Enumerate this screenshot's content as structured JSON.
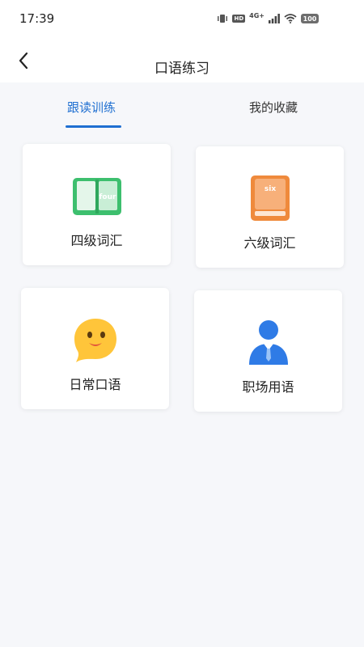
{
  "status_bar": {
    "time": "17:39",
    "network": "4G+",
    "hd_badge": "HD",
    "battery": "100"
  },
  "nav": {
    "title": "口语练习"
  },
  "tabs": [
    {
      "label": "跟读训练",
      "active": true
    },
    {
      "label": "我的收藏",
      "active": false
    }
  ],
  "cards": [
    {
      "label": "四级词汇",
      "icon": "green-book-icon",
      "icon_text": "four",
      "color": "#3dbf6e"
    },
    {
      "label": "六级词汇",
      "icon": "orange-book-icon",
      "icon_text": "six",
      "color": "#ef8a3c"
    },
    {
      "label": "日常口语",
      "icon": "smiley-chat-icon",
      "color": "#ffc53a"
    },
    {
      "label": "职场用语",
      "icon": "business-person-icon",
      "color": "#2f7be6"
    }
  ],
  "colors": {
    "accent": "#1f6fd1",
    "background": "#f6f7fa"
  }
}
